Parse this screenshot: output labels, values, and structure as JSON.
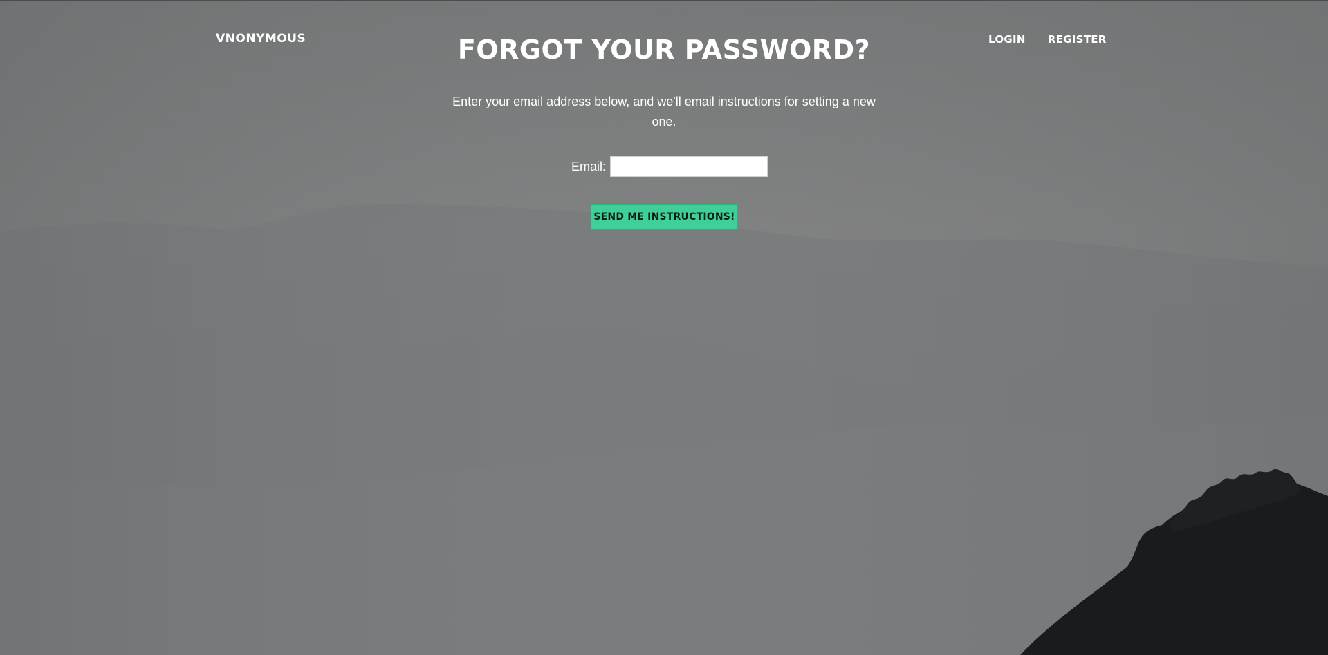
{
  "header": {
    "brand": "VNONYMOUS",
    "nav": [
      {
        "label": "LOGIN"
      },
      {
        "label": "REGISTER"
      }
    ]
  },
  "main": {
    "title": "FORGOT YOUR PASSWORD?",
    "description": "Enter your email address below, and we'll email instructions for setting a new one.",
    "email_label": "Email:",
    "email_value": "",
    "email_placeholder": "",
    "submit_label": "SEND ME INSTRUCTIONS!"
  },
  "colors": {
    "background_overlay": "#7d7e7f",
    "button_accent": "#3fcf99",
    "text": "#ffffff"
  }
}
